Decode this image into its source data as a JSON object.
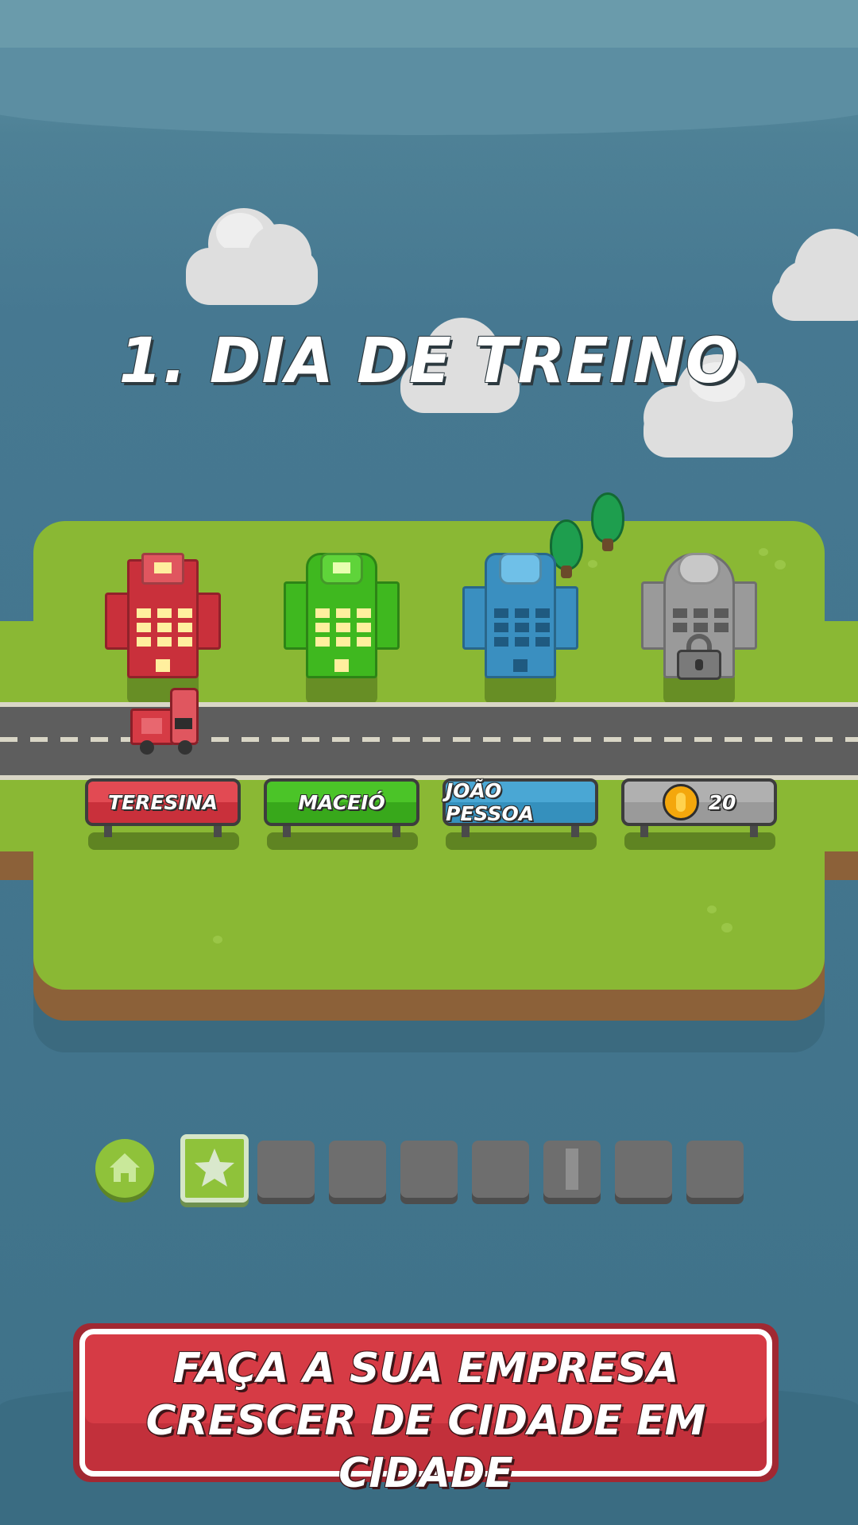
{
  "level": {
    "title": "1. DIA DE TREINO"
  },
  "cities": [
    {
      "name": "TERESINA",
      "color": "#d63b45",
      "building_color": "#c9303b",
      "locked": false
    },
    {
      "name": "MACEIÓ",
      "color": "#3fae1f",
      "building_color": "#3fb81f",
      "locked": false
    },
    {
      "name": "JOÃO PESSOA",
      "color": "#3d97c4",
      "building_color": "#3a8fc0",
      "locked": false
    },
    {
      "name": "20",
      "color": "#9e9e9e",
      "building_color": "#9a9a9a",
      "locked": true,
      "price_icon": "coin-icon"
    }
  ],
  "level_bar": {
    "home_icon": "home-icon",
    "current_level_icon": "star-icon",
    "total_levels": 8,
    "current_level": 1
  },
  "banner": {
    "line1": "FAÇA A SUA EMPRESA",
    "line2": "CRESCER DE CIDADE EM CIDADE"
  },
  "colors": {
    "grass": "#8ab834",
    "sky": "#467891",
    "banner": "#d63b45"
  }
}
